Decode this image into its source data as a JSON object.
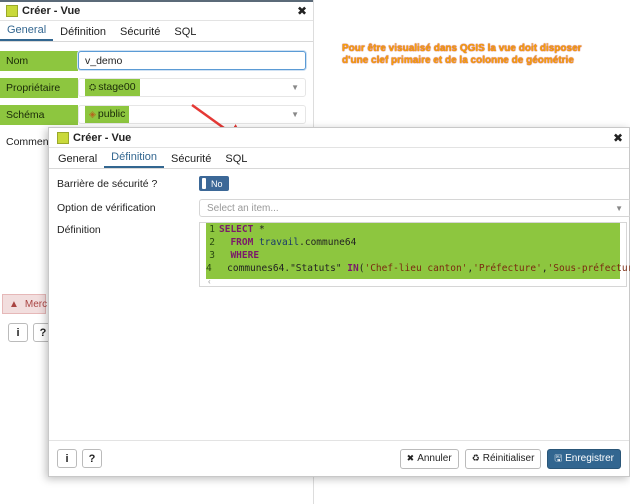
{
  "background_dialog": {
    "title": "Créer - Vue",
    "tabs": [
      {
        "label": "General",
        "active": true
      },
      {
        "label": "Définition",
        "active": false
      },
      {
        "label": "Sécurité",
        "active": false
      },
      {
        "label": "SQL",
        "active": false
      }
    ],
    "fields": {
      "nom": {
        "label": "Nom",
        "value": "v_demo"
      },
      "proprietaire": {
        "label": "Propriétaire",
        "value": "stage00"
      },
      "schema": {
        "label": "Schéma",
        "value": "public"
      },
      "commentaire": {
        "label": "Comment"
      }
    },
    "alert_text": "Merc"
  },
  "annotation": "Pour être visualisé dans QGIS la vue doit disposer d'une clef primaire et de la colonne de géométrie",
  "foreground_dialog": {
    "title": "Créer - Vue",
    "tabs": [
      {
        "label": "General",
        "active": false
      },
      {
        "label": "Définition",
        "active": true
      },
      {
        "label": "Sécurité",
        "active": false
      },
      {
        "label": "SQL",
        "active": false
      }
    ],
    "barriere": {
      "label": "Barrière de sécurité ?",
      "value": "No"
    },
    "verification": {
      "label": "Option de vérification",
      "placeholder": "Select an item..."
    },
    "definition": {
      "label": "Définition",
      "lines": [
        {
          "n": "1",
          "parts": [
            [
              "kw",
              "SELECT"
            ],
            [
              "",
              " *"
            ]
          ]
        },
        {
          "n": "2",
          "parts": [
            [
              "",
              "  "
            ],
            [
              "kw",
              "FROM"
            ],
            [
              "",
              " "
            ],
            [
              "tbl",
              "travail"
            ],
            [
              "",
              ".commune64"
            ]
          ]
        },
        {
          "n": "3",
          "parts": [
            [
              "",
              "  "
            ],
            [
              "kw",
              "WHERE"
            ]
          ]
        },
        {
          "n": "4",
          "parts": [
            [
              "",
              "  communes64.\"Statuts\" "
            ],
            [
              "kw",
              "IN"
            ],
            [
              "",
              "("
            ],
            [
              "str",
              "'Chef-lieu canton'"
            ],
            [
              "",
              ","
            ],
            [
              "str",
              "'Préfecture'"
            ],
            [
              "",
              ","
            ],
            [
              "str",
              "'Sous-préfecture'"
            ],
            [
              "",
              ")"
            ]
          ]
        }
      ]
    },
    "buttons": {
      "info": "i",
      "help": "?",
      "annuler": "Annuler",
      "reinitialiser": "Réinitialiser",
      "enregistrer": "Enregistrer"
    }
  },
  "colors": {
    "highlight_green": "#8dc63f",
    "primary_blue": "#326690",
    "annotation_orange": "#f5a20a",
    "arrow_red": "#e53935"
  },
  "icons": [
    "close-icon",
    "user-icon",
    "schema-icon",
    "warning-icon",
    "info-icon",
    "help-icon",
    "cancel-icon",
    "reset-icon",
    "save-icon"
  ]
}
